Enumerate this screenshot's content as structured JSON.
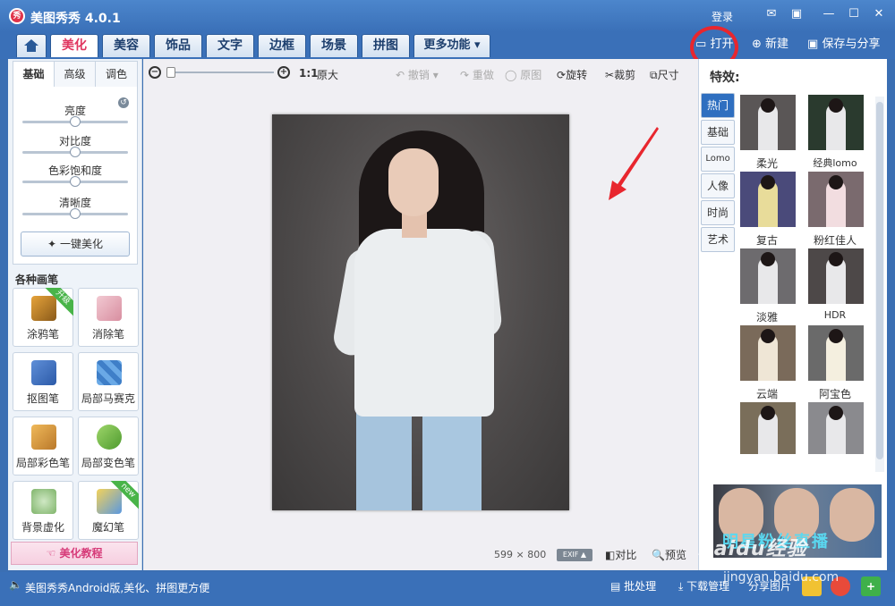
{
  "app": {
    "title": "美图秀秀 4.0.1",
    "logo_text": "秀"
  },
  "titlebar": {
    "login": "登录"
  },
  "tabs": [
    {
      "label": "美化",
      "active": true
    },
    {
      "label": "美容",
      "active": false
    },
    {
      "label": "饰品",
      "active": false
    },
    {
      "label": "文字",
      "active": false
    },
    {
      "label": "边框",
      "active": false
    },
    {
      "label": "场景",
      "active": false
    },
    {
      "label": "拼图",
      "active": false
    },
    {
      "label": "更多功能 ▾",
      "active": false
    }
  ],
  "file_actions": {
    "open": "打开",
    "new": "新建",
    "save": "保存与分享"
  },
  "adjust": {
    "subtabs": [
      "基础",
      "高级",
      "调色"
    ],
    "sliders": [
      {
        "label": "亮度",
        "value": 0.5
      },
      {
        "label": "对比度",
        "value": 0.5
      },
      {
        "label": "色彩饱和度",
        "value": 0.5
      },
      {
        "label": "清晰度",
        "value": 0.5
      }
    ],
    "onekey": "一键美化"
  },
  "brushes": {
    "heading": "各种画笔",
    "items": [
      {
        "label": "涂鸦笔",
        "badge": "升级"
      },
      {
        "label": "消除笔",
        "badge": ""
      },
      {
        "label": "抠图笔",
        "badge": ""
      },
      {
        "label": "局部马赛克",
        "badge": ""
      },
      {
        "label": "局部彩色笔",
        "badge": ""
      },
      {
        "label": "局部变色笔",
        "badge": ""
      },
      {
        "label": "背景虚化",
        "badge": ""
      },
      {
        "label": "魔幻笔",
        "badge": "new"
      }
    ],
    "tutorial": "美化教程"
  },
  "toolbar": {
    "ratio": "1:1",
    "original_size": "原大",
    "undo": "撤销",
    "redo": "重做",
    "original": "原图",
    "rotate": "旋转",
    "crop": "裁剪",
    "size": "尺寸",
    "zoom_level": 0.0
  },
  "image_info": {
    "width": "599",
    "times": "×",
    "height": "800",
    "exif": "EXIF ▲",
    "compare": "对比",
    "preview": "预览"
  },
  "effects": {
    "title": "特效:",
    "categories": [
      {
        "label": "热门",
        "active": true
      },
      {
        "label": "基础",
        "active": false
      },
      {
        "label": "Lomo",
        "active": false
      },
      {
        "label": "人像",
        "active": false
      },
      {
        "label": "时尚",
        "active": false
      },
      {
        "label": "艺术",
        "active": false
      }
    ],
    "items": [
      {
        "label": "柔光",
        "tint": "#8d8a8f"
      },
      {
        "label": "经典lomo",
        "tint": "#2a3a2e"
      },
      {
        "label": "复古",
        "tint": "#5a5a8a"
      },
      {
        "label": "粉红佳人",
        "tint": "#7a6a6e"
      },
      {
        "label": "淡雅",
        "tint": "#6d6b6e"
      },
      {
        "label": "HDR",
        "tint": "#5a5555"
      },
      {
        "label": "云端",
        "tint": "#7a6a5a"
      },
      {
        "label": "阿宝色",
        "tint": "#6a6a6a"
      },
      {
        "label": "",
        "tint": "#7a6e5a"
      },
      {
        "label": "",
        "tint": "#8a8a8e"
      }
    ]
  },
  "banner": {
    "text": "明星粉丝直播"
  },
  "status": {
    "message": "美图秀秀Android版,美化、拼图更方便",
    "batch": "批处理",
    "download": "下载管理",
    "share": "分享图片"
  },
  "watermark": {
    "brand": "Baidu经验",
    "url": "jingyan.baidu.com"
  }
}
